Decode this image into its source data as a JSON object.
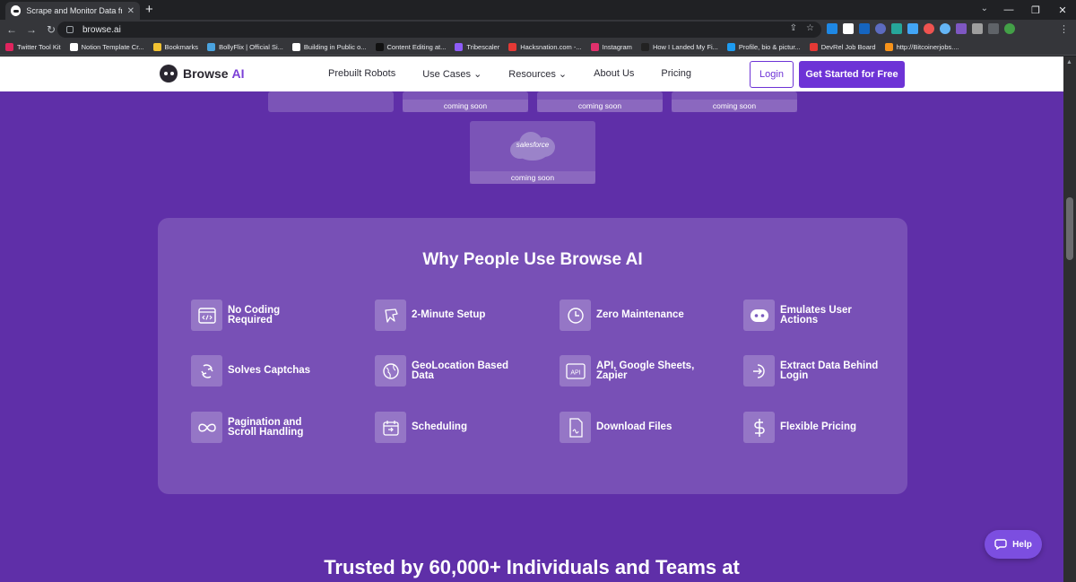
{
  "browser": {
    "tab_title": "Scrape and Monitor Data from Any",
    "url": "browse.ai",
    "bookmarks": [
      {
        "label": "Twitter Tool Kit",
        "color": "#e0245e"
      },
      {
        "label": "Notion Template Cr...",
        "color": "#ffffff"
      },
      {
        "label": "Bookmarks",
        "color": "#f1c232"
      },
      {
        "label": "BollyFlix | Official Si...",
        "color": "#4aa3df"
      },
      {
        "label": "Building in Public o...",
        "color": "#ffffff"
      },
      {
        "label": "Content Editing at...",
        "color": "#111111"
      },
      {
        "label": "Tribescaler",
        "color": "#8e5cf7"
      },
      {
        "label": "Hacksnation.com -...",
        "color": "#e53935"
      },
      {
        "label": "Instagram",
        "color": "#e1306c"
      },
      {
        "label": "How I Landed My Fi...",
        "color": "#222222"
      },
      {
        "label": "Profile, bio & pictur...",
        "color": "#1d9bf0"
      },
      {
        "label": "DevRel Job Board",
        "color": "#e53935"
      },
      {
        "label": "http://Bitcoinerjobs....",
        "color": "#f7931a"
      }
    ]
  },
  "site": {
    "brand_first": "Browse",
    "brand_second": "AI",
    "nav": [
      "Prebuilt Robots",
      "Use Cases ⌄",
      "Resources ⌄",
      "About Us",
      "Pricing"
    ],
    "login": "Login",
    "get_started": "Get Started for Free"
  },
  "integrations": {
    "coming_soon": "coming soon",
    "salesforce_label": "salesforce"
  },
  "why": {
    "title": "Why People Use Browse AI",
    "features": [
      {
        "label": "No Coding Required",
        "icon": "code-window-icon"
      },
      {
        "label": "2-Minute Setup",
        "icon": "setup-icon"
      },
      {
        "label": "Zero Maintenance",
        "icon": "clock-icon"
      },
      {
        "label": "Emulates User Actions",
        "icon": "robot-icon"
      },
      {
        "label": "Solves Captchas",
        "icon": "captcha-icon"
      },
      {
        "label": "GeoLocation Based Data",
        "icon": "globe-icon"
      },
      {
        "label": "API, Google Sheets, Zapier",
        "icon": "api-icon"
      },
      {
        "label": "Extract Data Behind Login",
        "icon": "login-icon"
      },
      {
        "label": "Pagination and Scroll Handling",
        "icon": "infinity-icon"
      },
      {
        "label": "Scheduling",
        "icon": "calendar-icon"
      },
      {
        "label": "Download Files",
        "icon": "file-icon"
      },
      {
        "label": "Flexible Pricing",
        "icon": "dollar-icon"
      }
    ]
  },
  "trusted_title": "Trusted by 60,000+ Individuals and Teams at",
  "help_label": "Help",
  "colors": {
    "brand_purple": "#6d33d6",
    "page_bg": "#5f2fa8"
  }
}
